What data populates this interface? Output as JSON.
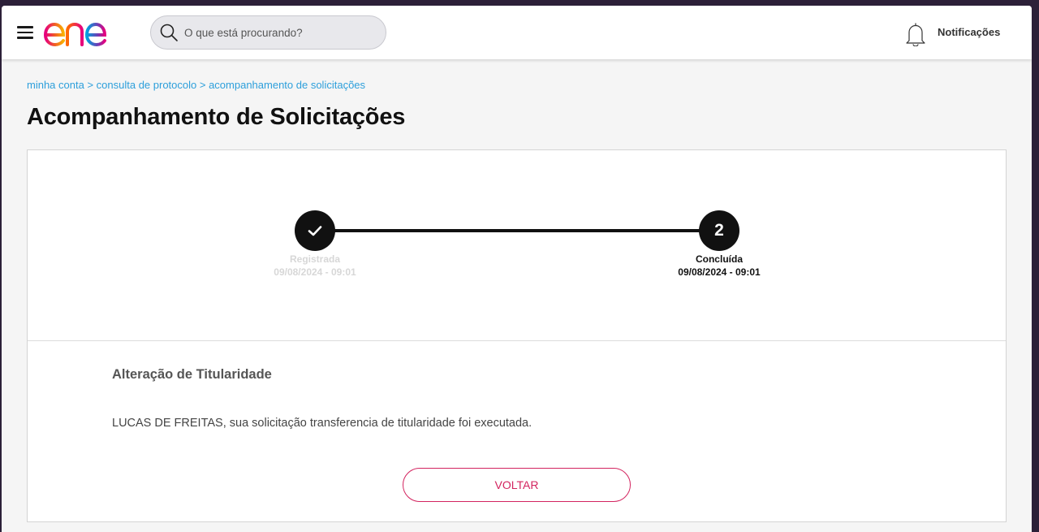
{
  "header": {
    "logo_text": "enel",
    "search_placeholder": "O que está procurando?",
    "notifications_label": "Notificações"
  },
  "breadcrumb": {
    "items": [
      "minha conta",
      "consulta de protocolo",
      "acompanhamento de solicitações"
    ],
    "separator": " > "
  },
  "page": {
    "title": "Acompanhamento de Solicitações"
  },
  "stepper": {
    "steps": [
      {
        "label": "Registrada",
        "datetime": "09/08/2024 - 09:01",
        "icon": "check-icon"
      },
      {
        "label": "Concluída",
        "datetime": "09/08/2024 - 09:01",
        "number": "2"
      }
    ]
  },
  "request": {
    "title": "Alteração de Titularidade",
    "message": "LUCAS DE FREITAS, sua solicitação transferencia de titularidade foi executada."
  },
  "actions": {
    "back_label": "VOLTAR"
  },
  "colors": {
    "accent": "#d3245f",
    "link": "#2d9fdb",
    "text_dark": "#111111"
  }
}
